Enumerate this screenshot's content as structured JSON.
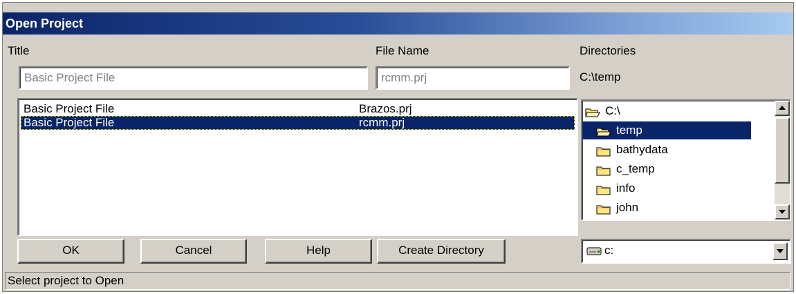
{
  "window": {
    "title": "Open Project"
  },
  "labels": {
    "title": "Title",
    "file_name": "File Name",
    "directories": "Directories"
  },
  "fields": {
    "title_value": "Basic Project File",
    "file_name_value": "rcmm.prj",
    "current_directory": "C:\\temp"
  },
  "projects": [
    {
      "title": "Basic Project File",
      "file": "Brazos.prj",
      "selected": false
    },
    {
      "title": "Basic Project File",
      "file": "rcmm.prj",
      "selected": true
    }
  ],
  "directories": [
    {
      "name": "C:\\",
      "icon": "open-folder-icon",
      "selected": false
    },
    {
      "name": "temp",
      "icon": "open-folder-icon",
      "selected": true
    },
    {
      "name": "bathydata",
      "icon": "folder-icon",
      "selected": false
    },
    {
      "name": "c_temp",
      "icon": "folder-icon",
      "selected": false
    },
    {
      "name": "info",
      "icon": "folder-icon",
      "selected": false
    },
    {
      "name": "john",
      "icon": "folder-icon",
      "selected": false
    }
  ],
  "buttons": {
    "ok": "OK",
    "cancel": "Cancel",
    "help": "Help",
    "create_directory": "Create Directory"
  },
  "drive": {
    "value": "c:",
    "icon": "drive-icon"
  },
  "status": "Select project to Open",
  "colors": {
    "title_start": "#0a246a",
    "title_end": "#a6caf0",
    "face": "#d4d0c8",
    "selection": "#0a246a",
    "folder": "#ffe680"
  }
}
